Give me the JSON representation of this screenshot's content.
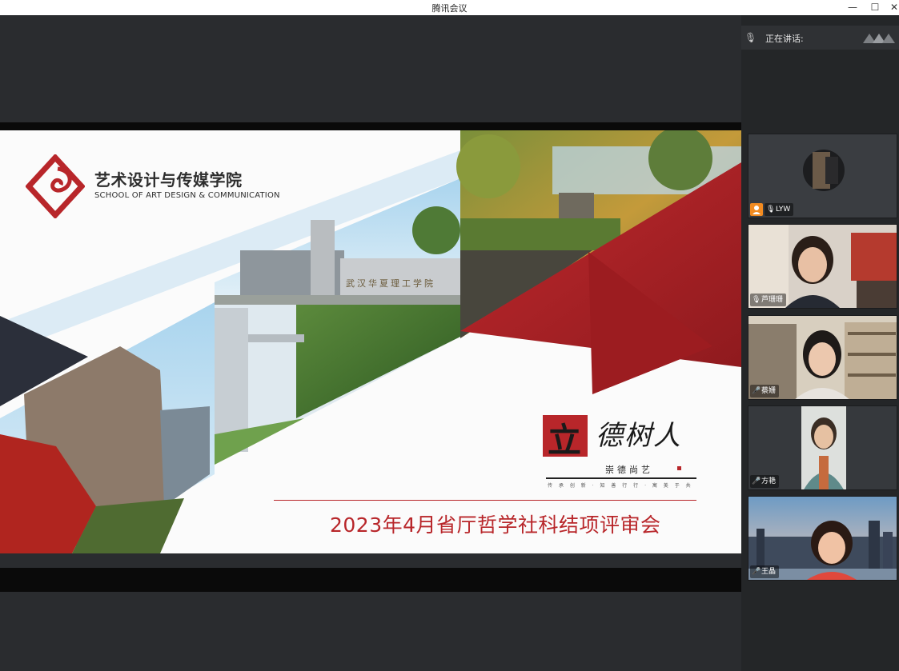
{
  "window": {
    "title": "腾讯会议",
    "minimize_glyph": "—",
    "maximize_glyph": "☐",
    "close_glyph": "✕"
  },
  "sidebar": {
    "speaking_label": "正在讲话:",
    "participants": [
      {
        "name": "LYW",
        "has_host_badge": true,
        "mic": "muted"
      },
      {
        "name": "芦珊珊",
        "mic": "muted"
      },
      {
        "name": "蔡姗",
        "mic": "on"
      },
      {
        "name": "方艳",
        "mic": "on"
      },
      {
        "name": "王晶",
        "mic": "on"
      }
    ]
  },
  "slide": {
    "school_name_cn": "艺术设计与传媒学院",
    "school_name_en": "SCHOOL OF ART DESIGN & COMMUNICATION",
    "calligraphy_seal": "立",
    "calligraphy_chars": "德树人",
    "calligraphy_sub": "崇德尚艺",
    "calligraphy_mini": "传 承 创 新 · 知 善 行 行 · 寓 美 于 共",
    "title": "2023年4月省厅哲学社科结项评审会",
    "building_sign": "武汉华夏理工学院",
    "colors": {
      "accent_red": "#b8262a",
      "dark_navy": "#2b2f3a"
    }
  }
}
